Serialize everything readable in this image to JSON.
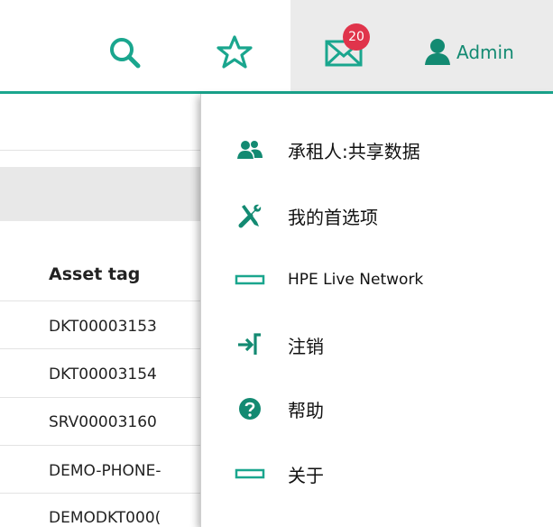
{
  "header": {
    "mail_badge_count": "20",
    "user_name": "Admin",
    "accent_color": "#1aa68e"
  },
  "table": {
    "column_header": "Asset tag",
    "rows": [
      "DKT00003153",
      "DKT00003154",
      "SRV00003160",
      "DEMO-PHONE-",
      "DEMODKT000("
    ]
  },
  "menu": {
    "items": [
      {
        "label": "承租人:共享数据",
        "icon": "tenant-users-icon"
      },
      {
        "label": "我的首选项",
        "icon": "wrench-screwdriver-icon"
      },
      {
        "label": "HPE Live Network",
        "icon": "live-network-icon"
      },
      {
        "label": "注销",
        "icon": "logout-icon"
      },
      {
        "label": "帮助",
        "icon": "help-icon"
      },
      {
        "label": "关于",
        "icon": "about-icon"
      }
    ]
  }
}
